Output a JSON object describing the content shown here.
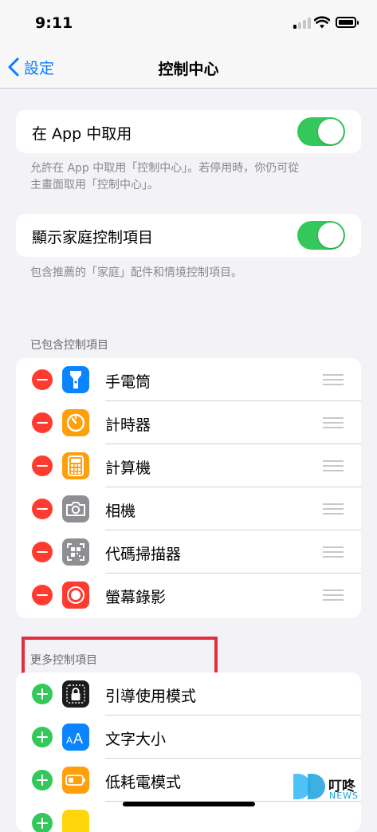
{
  "status_bar": {
    "time": "9:11"
  },
  "nav": {
    "back_label": "設定",
    "title": "控制中心"
  },
  "access_in_apps": {
    "label": "在 App 中取用",
    "enabled": true,
    "note_line1": "允許在 App 中取用「控制中心」。若停用時，你仍可從",
    "note_line2": "主畫面取用「控制中心」。"
  },
  "home_controls": {
    "label": "顯示家庭控制項目",
    "enabled": true,
    "note": "包含推薦的「家庭」配件和情境控制項目。"
  },
  "included": {
    "header": "已包含控制項目",
    "items": [
      {
        "label": "手電筒",
        "icon": "flashlight-icon",
        "color": "#0a84ff"
      },
      {
        "label": "計時器",
        "icon": "timer-icon",
        "color": "#ff9f0a"
      },
      {
        "label": "計算機",
        "icon": "calculator-icon",
        "color": "#ff9f0a"
      },
      {
        "label": "相機",
        "icon": "camera-icon",
        "color": "#8e8e93"
      },
      {
        "label": "代碼掃描器",
        "icon": "qr-scanner-icon",
        "color": "#8e8e93"
      },
      {
        "label": "螢幕錄影",
        "icon": "screen-record-icon",
        "color": "#ff3b30"
      }
    ]
  },
  "more": {
    "header": "更多控制項目",
    "items": [
      {
        "label": "引導使用模式",
        "icon": "guided-access-icon",
        "color": "#1c1c1e"
      },
      {
        "label": "文字大小",
        "icon": "text-size-icon",
        "color": "#0a84ff"
      },
      {
        "label": "低耗電模式",
        "icon": "low-power-icon",
        "color": "#ff9f0a"
      }
    ]
  },
  "watermark": {
    "brand": "叮咚",
    "sub": "NEWS"
  }
}
